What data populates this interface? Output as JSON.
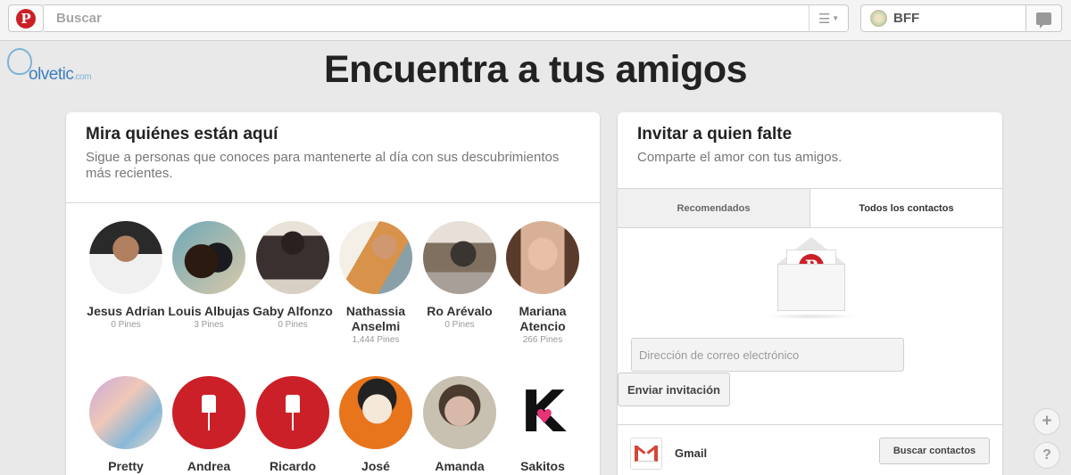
{
  "header": {
    "logo_letter": "P",
    "search_placeholder": "Buscar",
    "menu_icon": "list-icon",
    "user_name": "BFF",
    "messages_icon": "speech-bubble-icon"
  },
  "watermark": {
    "brand": "olvetic",
    "suffix": ".com"
  },
  "page_title": "Encuentra a tus amigos",
  "find_friends": {
    "title": "Mira quiénes están aquí",
    "subtitle": "Sigue a personas que conoces para mantenerte al día con sus descubrimientos más recientes.",
    "people": [
      {
        "name": "Jesus Adrian",
        "pins": "0 Pines"
      },
      {
        "name": "Louis Albujas",
        "pins": "3 Pines"
      },
      {
        "name": "Gaby Alfonzo",
        "pins": "0 Pines"
      },
      {
        "name": "Nathassia Anselmi",
        "pins": "1,444 Pines"
      },
      {
        "name": "Ro Arévalo",
        "pins": "0 Pines"
      },
      {
        "name": "Mariana Atencio",
        "pins": "266 Pines"
      },
      {
        "name": "Pretty",
        "pins": ""
      },
      {
        "name": "Andrea",
        "pins": ""
      },
      {
        "name": "Ricardo",
        "pins": ""
      },
      {
        "name": "José",
        "pins": ""
      },
      {
        "name": "Amanda",
        "pins": ""
      },
      {
        "name": "Sakitos",
        "pins": ""
      }
    ]
  },
  "invite": {
    "title": "Invitar a quien falte",
    "subtitle": "Comparte el amor con tus amigos.",
    "tabs": [
      {
        "label": "Recomendados"
      },
      {
        "label": "Todos los contactos"
      }
    ],
    "envelope_logo": "P",
    "email_placeholder": "Dirección de correo electrónico",
    "send_label": "Enviar invitación",
    "gmail_label": "Gmail",
    "find_contacts_label": "Buscar contactos"
  },
  "fab": {
    "plus": "+",
    "help": "?"
  },
  "colors": {
    "brand_red": "#cb2027",
    "background": "#e9e9e9",
    "gmail_red": "#d44638"
  }
}
